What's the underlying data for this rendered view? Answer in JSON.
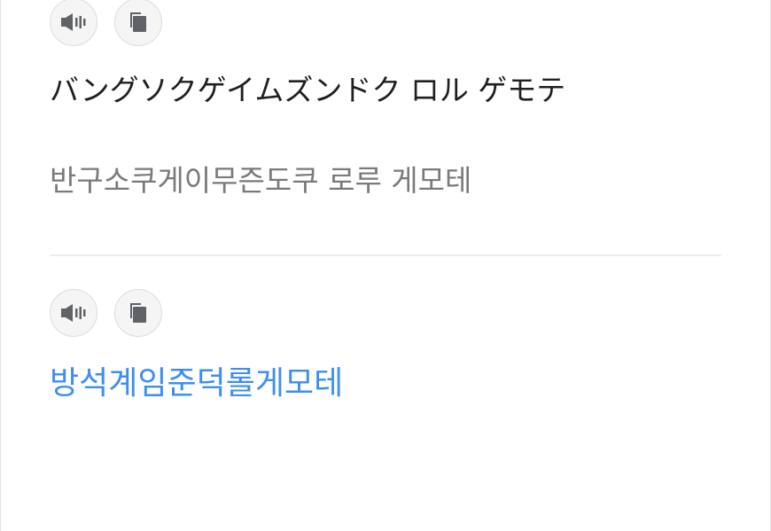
{
  "source": {
    "speak_icon": "speaker-icon",
    "copy_icon": "copy-icon",
    "text": "バングソクゲイムズンドク ロル ゲモテ",
    "romanization": "반구소쿠게이무즌도쿠 로루 게모테"
  },
  "target": {
    "speak_icon": "speaker-icon",
    "copy_icon": "copy-icon",
    "text": "방석계임준덕롤게모테"
  },
  "colors": {
    "translation": "#3e8ef0",
    "romanization": "#7a7a7a",
    "icon": "#5f6368",
    "icon_bg": "#f5f5f5"
  }
}
